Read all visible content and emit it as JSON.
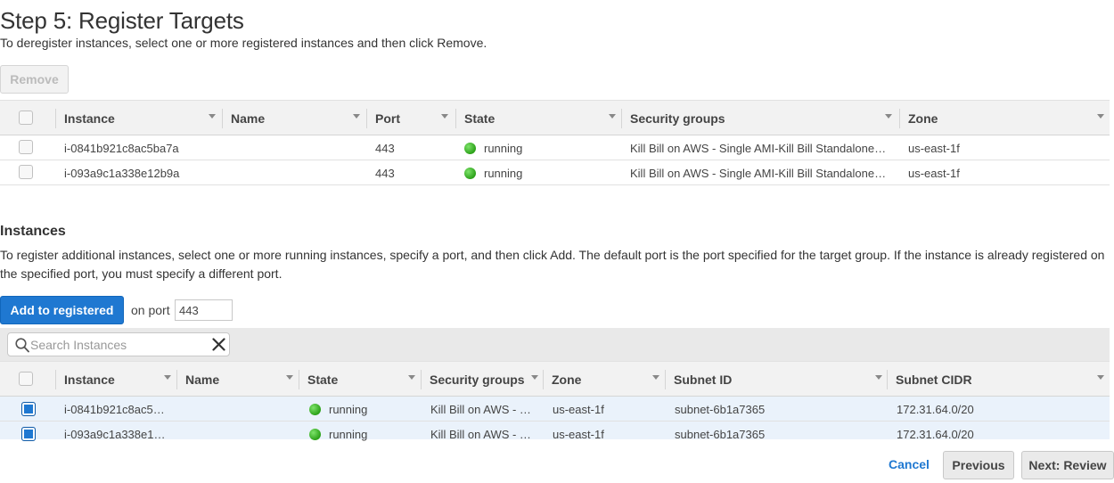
{
  "page": {
    "title": "Step 5: Register Targets",
    "deregister_hint": "To deregister instances, select one or more registered instances and then click Remove.",
    "remove_label": "Remove"
  },
  "registered": {
    "columns": [
      "Instance",
      "Name",
      "Port",
      "State",
      "Security groups",
      "Zone"
    ],
    "rows": [
      {
        "instance": "i-0841b921c8ac5ba7a",
        "name": "",
        "port": "443",
        "state": "running",
        "security_groups": "Kill Bill on AWS - Single AMI-Kill Bill Standalone…",
        "zone": "us-east-1f",
        "checked": false
      },
      {
        "instance": "i-093a9c1a338e12b9a",
        "name": "",
        "port": "443",
        "state": "running",
        "security_groups": "Kill Bill on AWS - Single AMI-Kill Bill Standalone…",
        "zone": "us-east-1f",
        "checked": false
      }
    ]
  },
  "instances": {
    "heading": "Instances",
    "hint": "To register additional instances, select one or more running instances, specify a port, and then click Add. The default port is the port specified for the target group. If the instance is already registered on the specified port, you must specify a different port.",
    "add_label": "Add to registered",
    "on_port_label": "on port",
    "port_value": "443",
    "search_placeholder": "Search Instances",
    "columns": [
      "Instance",
      "Name",
      "State",
      "Security groups",
      "Zone",
      "Subnet ID",
      "Subnet CIDR"
    ],
    "rows": [
      {
        "instance": "i-0841b921c8ac5…",
        "name": "",
        "state": "running",
        "security_groups": "Kill Bill on AWS - …",
        "zone": "us-east-1f",
        "subnet_id": "subnet-6b1a7365",
        "subnet_cidr": "172.31.64.0/20",
        "checked": true
      },
      {
        "instance": "i-093a9c1a338e1…",
        "name": "",
        "state": "running",
        "security_groups": "Kill Bill on AWS - …",
        "zone": "us-east-1f",
        "subnet_id": "subnet-6b1a7365",
        "subnet_cidr": "172.31.64.0/20",
        "checked": true
      }
    ]
  },
  "footer": {
    "cancel_label": "Cancel",
    "previous_label": "Previous",
    "next_label": "Next: Review"
  },
  "colors": {
    "primary_blue": "#1f78d1",
    "running_green": "#2ca119",
    "header_gray": "#f2f2f2",
    "selected_row": "#eaf2fb"
  }
}
